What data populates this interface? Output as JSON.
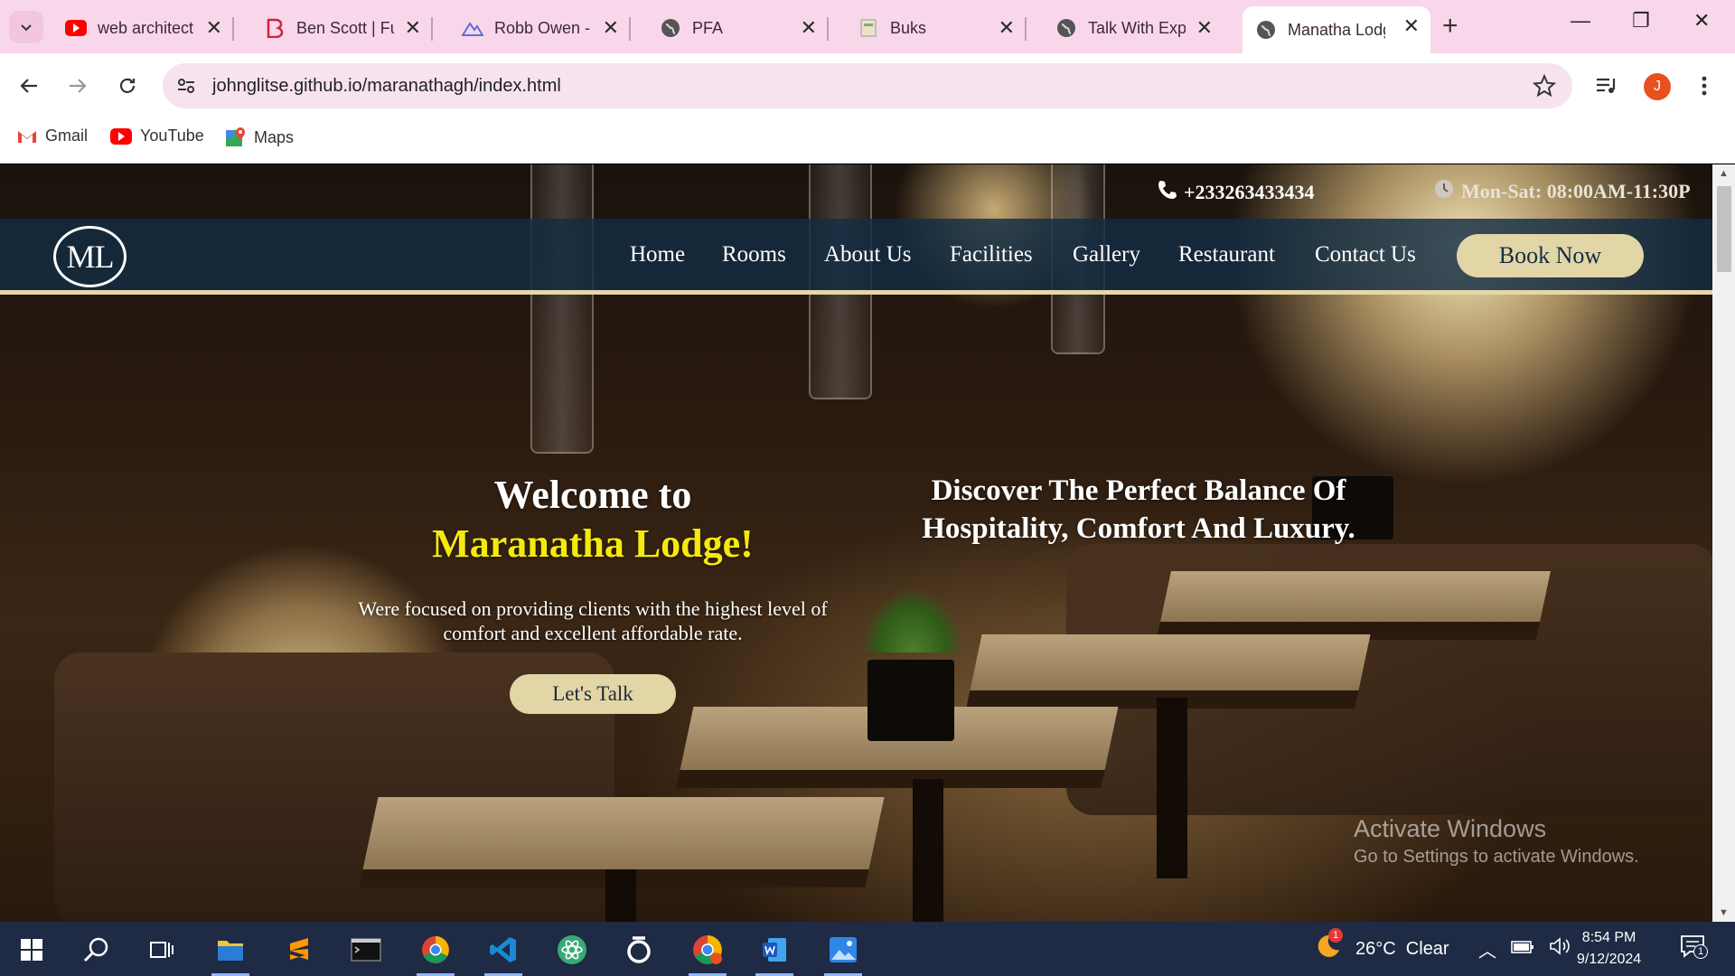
{
  "browser": {
    "tabs": [
      {
        "title": "web architect",
        "icon": "youtube-icon"
      },
      {
        "title": "Ben Scott | Fu",
        "icon": "b-icon"
      },
      {
        "title": "Robb Owen -",
        "icon": "mountain-icon"
      },
      {
        "title": "PFA",
        "icon": "globe-icon"
      },
      {
        "title": "Buks",
        "icon": "page-icon"
      },
      {
        "title": "Talk With Expe",
        "icon": "globe-icon"
      },
      {
        "title": "Manatha Lodg",
        "icon": "globe-icon",
        "active": true
      }
    ],
    "url": "johnglitse.github.io/maranathagh/index.html",
    "profile_initial": "J",
    "bookmarks": [
      {
        "label": "Gmail",
        "icon": "gmail-icon"
      },
      {
        "label": "YouTube",
        "icon": "youtube-icon"
      },
      {
        "label": "Maps",
        "icon": "maps-icon"
      }
    ]
  },
  "site": {
    "phone": "+233263433434",
    "hours": "Mon-Sat: 08:00AM-11:30P",
    "logo": "ML",
    "nav": [
      "Home",
      "Rooms",
      "About Us",
      "Facilities",
      "Gallery",
      "Restaurant",
      "Contact Us"
    ],
    "book_now": "Book Now",
    "welcome_line1": "Welcome to",
    "welcome_line2": "Maranatha Lodge!",
    "description": "Were focused on providing clients with the highest level of comfort and excellent affordable rate.",
    "cta": "Let's Talk",
    "tagline": "Discover The Perfect Balance Of Hospitality, Comfort And Luxury."
  },
  "watermark": {
    "line1": "Activate Windows",
    "line2": "Go to Settings to activate Windows."
  },
  "taskbar": {
    "weather": "26°C  Clear",
    "weather_badge": "1",
    "time": "8:54 PM",
    "date": "9/12/2024",
    "notification_count": "1"
  },
  "colors": {
    "tabstrip": "#f9d7ea",
    "nav_bg": "#122d44",
    "accent_gold": "#e2d5a6",
    "welcome_yellow": "#f5e90d",
    "taskbar": "#1f2a44"
  }
}
